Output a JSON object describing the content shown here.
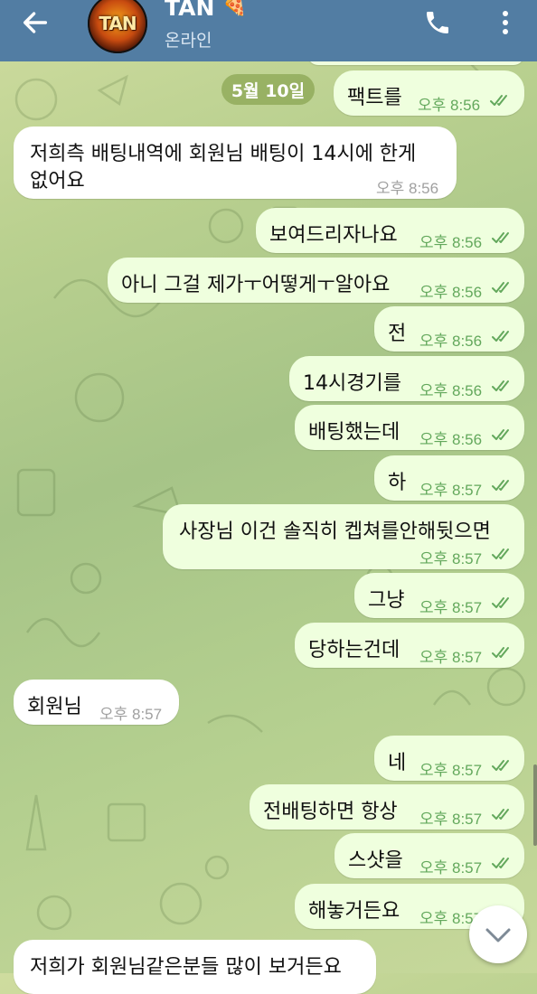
{
  "header": {
    "title": "TAN",
    "title_emoji": "🍕",
    "status": "온라인",
    "avatar_text": "TAN",
    "back_icon": "arrow-left-icon",
    "call_icon": "phone-icon",
    "menu_icon": "more-vertical-icon",
    "bar_color": "#527da3"
  },
  "date_separator": "5월 10일",
  "messages": [
    {
      "dir": "out",
      "text": "팩트를",
      "time": "오후 8:56",
      "read": true
    },
    {
      "dir": "in",
      "text": "저희측 배팅내역에 회원님 배팅이 14시에 한게",
      "text2": "없어요",
      "time": "오후 8:56"
    },
    {
      "dir": "out",
      "text": "보여드리자나요",
      "time": "오후 8:56",
      "read": true
    },
    {
      "dir": "out",
      "text": "아니 그걸 제가ㅜ어떻게ㅜ알아요",
      "time": "오후 8:56",
      "read": true
    },
    {
      "dir": "out",
      "text": "전",
      "time": "오후 8:56",
      "read": true
    },
    {
      "dir": "out",
      "text": "14시경기를",
      "time": "오후 8:56",
      "read": true
    },
    {
      "dir": "out",
      "text": "배팅했는데",
      "time": "오후 8:56",
      "read": true
    },
    {
      "dir": "out",
      "text": "하",
      "time": "오후 8:57",
      "read": true
    },
    {
      "dir": "out",
      "text": "사장님 이건 솔직히 켑쳐를안해뒷으면",
      "time": "오후 8:57",
      "read": true
    },
    {
      "dir": "out",
      "text": "그냥",
      "time": "오후 8:57",
      "read": true
    },
    {
      "dir": "out",
      "text": "당하는건데",
      "time": "오후 8:57",
      "read": true
    },
    {
      "dir": "in",
      "text": "회원님",
      "time": "오후 8:57"
    },
    {
      "dir": "out",
      "text": "네",
      "time": "오후 8:57",
      "read": true
    },
    {
      "dir": "out",
      "text": "전배팅하면 항상",
      "time": "오후 8:57",
      "read": true
    },
    {
      "dir": "out",
      "text": "스샷을",
      "time": "오후 8:57",
      "read": true
    },
    {
      "dir": "out",
      "text": "해놓거든요",
      "time": "오후 8:57",
      "read": true
    },
    {
      "dir": "in",
      "text": "저희가 회원님같은분들 많이 보거든요",
      "time": ""
    }
  ],
  "colors": {
    "outgoing_bubble": "#efffde",
    "incoming_bubble": "#ffffff",
    "read_check": "#63a85c"
  },
  "scroll_down_icon": "chevron-down-icon"
}
